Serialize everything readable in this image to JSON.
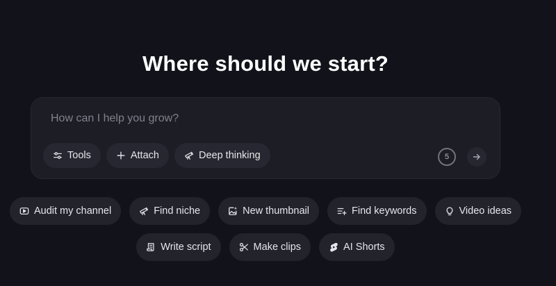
{
  "heading": "Where should we start?",
  "prompt": {
    "placeholder": "How can I help you grow?",
    "tools": [
      {
        "label": "Tools",
        "icon": "sliders-icon"
      },
      {
        "label": "Attach",
        "icon": "plus-icon"
      },
      {
        "label": "Deep thinking",
        "icon": "telescope-icon"
      }
    ],
    "counter": "5",
    "send_icon": "arrow-right-icon"
  },
  "suggestions": {
    "row1": [
      {
        "label": "Audit my channel",
        "icon": "play-box-icon"
      },
      {
        "label": "Find niche",
        "icon": "telescope-icon"
      },
      {
        "label": "New thumbnail",
        "icon": "image-sparkle-icon"
      },
      {
        "label": "Find keywords",
        "icon": "list-plus-icon"
      },
      {
        "label": "Video ideas",
        "icon": "lightbulb-icon"
      }
    ],
    "row2": [
      {
        "label": "Write script",
        "icon": "scroll-icon"
      },
      {
        "label": "Make clips",
        "icon": "scissors-icon"
      },
      {
        "label": "AI Shorts",
        "icon": "shorts-icon"
      }
    ]
  },
  "colors": {
    "background": "#12131a",
    "panel": "#1c1d25",
    "chip": "#262730",
    "text": "#e9eaee",
    "placeholder": "#80828d"
  }
}
